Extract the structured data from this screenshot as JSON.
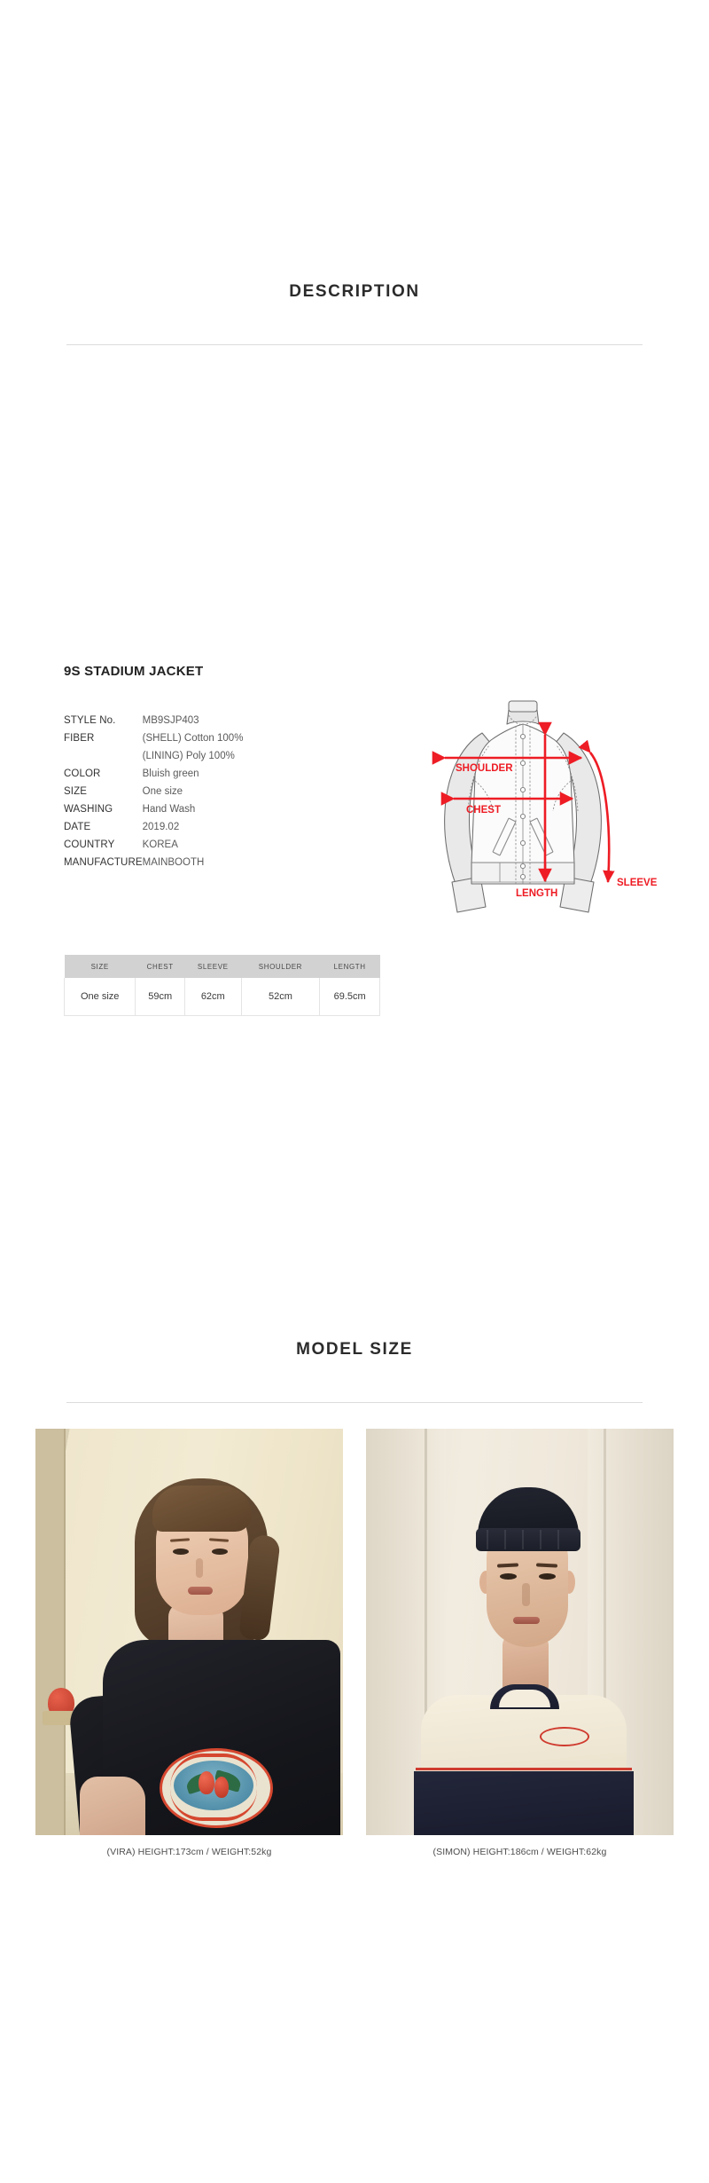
{
  "sections": {
    "description_heading": "DESCRIPTION",
    "modelsize_heading": "MODEL SIZE"
  },
  "product": {
    "title": "9S STADIUM JACKET",
    "specs": [
      {
        "key": "STYLE No.",
        "value": "MB9SJP403"
      },
      {
        "key": "FIBER",
        "value": "(SHELL) Cotton 100%"
      },
      {
        "key": "",
        "value": "(LINING) Poly 100%"
      },
      {
        "key": "COLOR",
        "value": "Bluish green"
      },
      {
        "key": "SIZE",
        "value": "One size"
      },
      {
        "key": "WASHING",
        "value": "Hand Wash"
      },
      {
        "key": "DATE",
        "value": "2019.02"
      },
      {
        "key": "COUNTRY",
        "value": "KOREA"
      },
      {
        "key": "MANUFACTURE",
        "value": "MAINBOOTH"
      }
    ]
  },
  "diagram": {
    "labels": {
      "shoulder": "SHOULDER",
      "chest": "CHEST",
      "length": "LENGTH",
      "sleeve": "SLEEVE"
    },
    "arrow_color": "#ee1c24"
  },
  "measure_table": {
    "headers": [
      "SIZE",
      "CHEST",
      "SLEEVE",
      "SHOULDER",
      "LENGTH"
    ],
    "rows": [
      [
        "One size",
        "59cm",
        "62cm",
        "52cm",
        "69.5cm"
      ]
    ],
    "header_bg": "#d2d2d2"
  },
  "models": [
    {
      "caption": "(VIRA) HEIGHT:173cm / WEIGHT:52kg"
    },
    {
      "caption": "(SIMON) HEIGHT:186cm / WEIGHT:62kg"
    }
  ],
  "colors": {
    "text": "#333333",
    "muted": "#5a5a5a",
    "divider": "#dcdcdc",
    "accent_red": "#ee1c24"
  }
}
